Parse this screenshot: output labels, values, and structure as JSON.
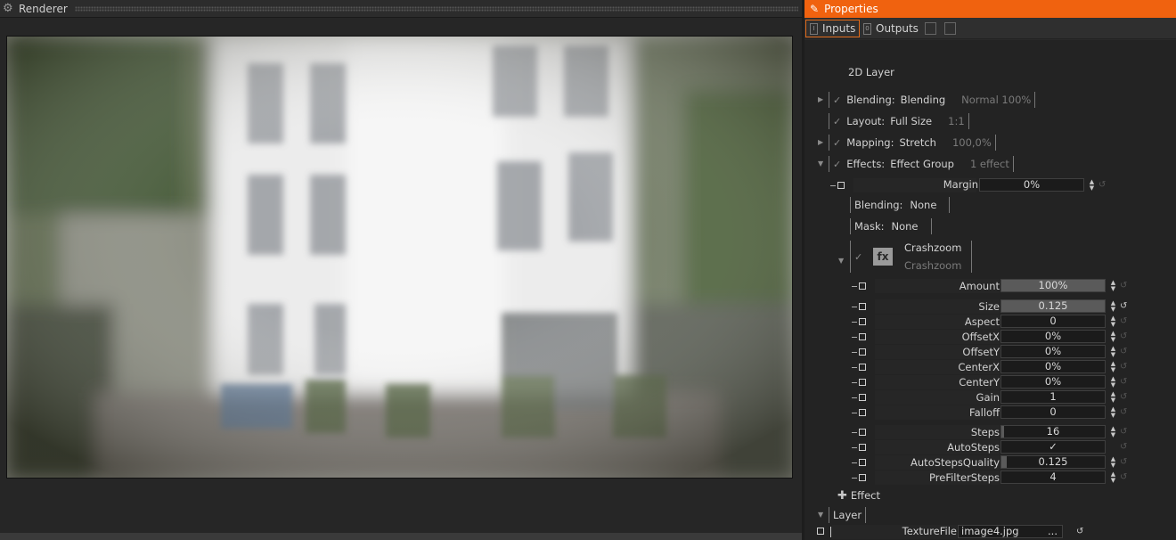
{
  "renderer": {
    "title": "Renderer"
  },
  "properties": {
    "title": "Properties",
    "tabs": [
      {
        "label": "Inputs",
        "active": true
      },
      {
        "label": "Outputs",
        "active": false
      }
    ],
    "layer_type": "2D Layer",
    "blending": {
      "label": "Blending:",
      "value": "Blending",
      "extra": "Normal 100%"
    },
    "layout": {
      "label": "Layout:",
      "value": "Full Size",
      "extra": "1:1"
    },
    "mapping": {
      "label": "Mapping:",
      "value": "Stretch",
      "extra": "100,0%"
    },
    "effects": {
      "label": "Effects:",
      "value": "Effect Group",
      "extra": "1 effect"
    },
    "margin": {
      "label": "Margin",
      "value": "0%"
    },
    "effect_blending": {
      "label": "Blending:",
      "value": "None"
    },
    "effect_mask": {
      "label": "Mask:",
      "value": "None"
    },
    "effect": {
      "icon": "fx",
      "name": "Crashzoom",
      "subname": "Crashzoom"
    },
    "params": [
      {
        "label": "Amount",
        "value": "100%",
        "fill": 1.0
      },
      {
        "label": "Size",
        "value": "0.125",
        "fill": 1.0
      },
      {
        "label": "Aspect",
        "value": "0",
        "fill": 0
      },
      {
        "label": "OffsetX",
        "value": "0%",
        "fill": 0
      },
      {
        "label": "OffsetY",
        "value": "0%",
        "fill": 0
      },
      {
        "label": "CenterX",
        "value": "0%",
        "fill": 0
      },
      {
        "label": "CenterY",
        "value": "0%",
        "fill": 0
      },
      {
        "label": "Gain",
        "value": "1",
        "fill": 0
      },
      {
        "label": "Falloff",
        "value": "0",
        "fill": 0
      },
      {
        "label": "Steps",
        "value": "16",
        "fill": 0.03
      },
      {
        "label": "AutoSteps",
        "value": "✓",
        "fill": 0
      },
      {
        "label": "AutoStepsQuality",
        "value": "0.125",
        "fill": 0.05
      },
      {
        "label": "PreFilterSteps",
        "value": "4",
        "fill": 0
      }
    ],
    "add_effect": "Effect",
    "layer_section": "Layer",
    "texture": {
      "label": "TextureFile",
      "value": "image4.jpg",
      "browse": "..."
    }
  },
  "colors": {
    "accent": "#f0620f",
    "panel_bg": "#232323",
    "field_fill": "#5a5a5a"
  },
  "icons": [
    "gear-icon",
    "pencil-icon",
    "checkmark-icon",
    "expand-arrow-icon",
    "spinner-arrows-icon",
    "reset-icon",
    "plus-icon",
    "fx-icon"
  ]
}
